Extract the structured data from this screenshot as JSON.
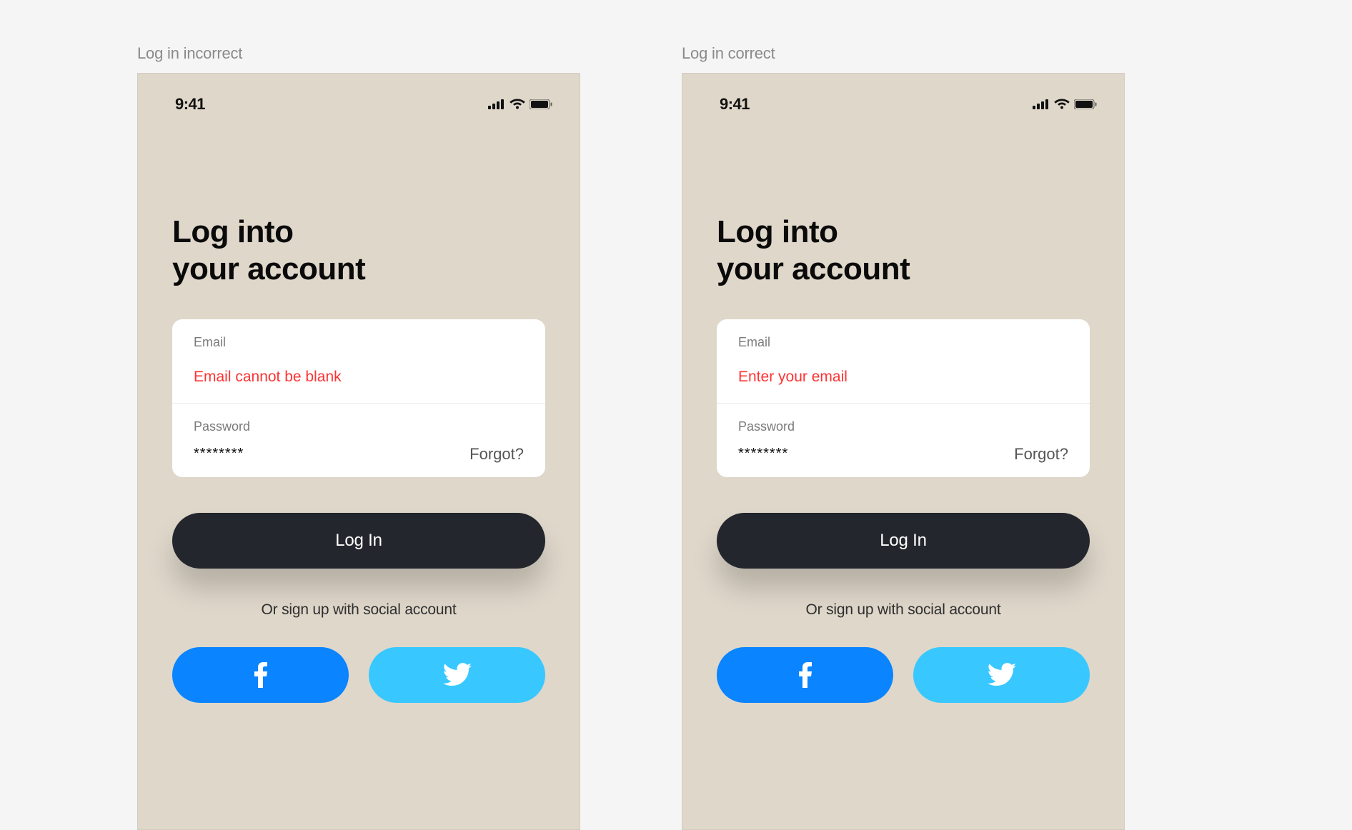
{
  "captions": {
    "incorrect": "Log in incorrect",
    "correct": "Log in correct"
  },
  "status": {
    "time": "9:41"
  },
  "title_line1": "Log into",
  "title_line2": "your account",
  "labels": {
    "email": "Email",
    "password": "Password"
  },
  "left": {
    "email_error": "Email cannot be blank",
    "password_value": "********"
  },
  "right": {
    "email_placeholder": "Enter your email",
    "password_value": "********"
  },
  "forgot": "Forgot?",
  "login_button": "Log In",
  "signup_caption": "Or sign up with social account",
  "icons": {
    "facebook": "facebook-icon",
    "twitter": "twitter-icon"
  },
  "colors": {
    "bg": "#f5f5f5",
    "phone_bg": "#dfd7ca",
    "error": "#ff3333",
    "button": "#23262d",
    "fb": "#0a84ff",
    "tw": "#38c8ff"
  }
}
